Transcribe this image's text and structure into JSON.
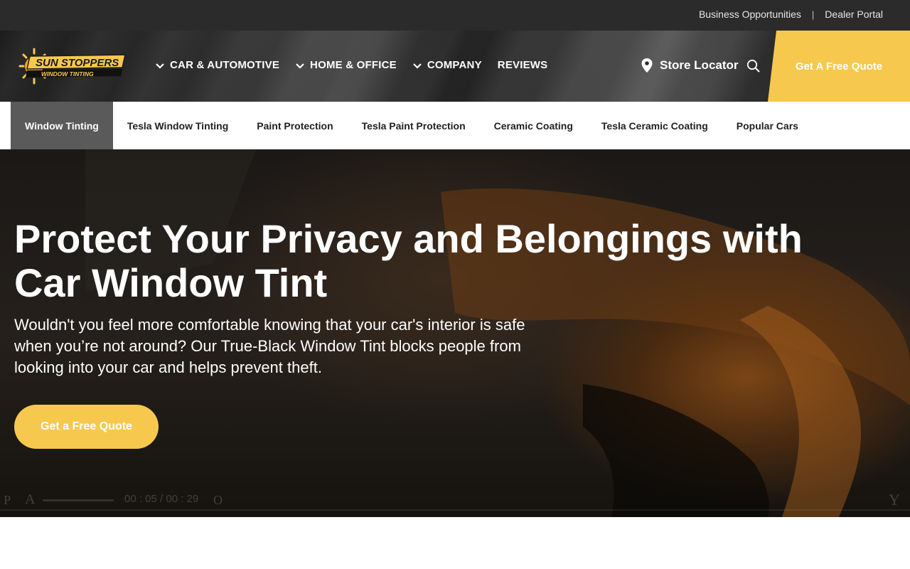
{
  "topbar": {
    "business_label": "Business Opportunities",
    "separator": "|",
    "dealer_label": "Dealer Portal"
  },
  "logo": {
    "line1": "SUN STOPPERS",
    "line2": "WINDOW TINTING"
  },
  "nav": {
    "items": [
      {
        "label": "CAR & AUTOMOTIVE",
        "has_dropdown": true
      },
      {
        "label": "HOME & OFFICE",
        "has_dropdown": true
      },
      {
        "label": "COMPANY",
        "has_dropdown": true
      },
      {
        "label": "REVIEWS",
        "has_dropdown": false
      }
    ],
    "store_locator": "Store Locator",
    "quote_label": "Get A Free Quote"
  },
  "subnav": {
    "tabs": [
      {
        "label": "Window Tinting",
        "active": true
      },
      {
        "label": "Tesla Window Tinting"
      },
      {
        "label": "Paint Protection"
      },
      {
        "label": "Tesla Paint Protection"
      },
      {
        "label": "Ceramic Coating"
      },
      {
        "label": "Tesla Ceramic Coating"
      },
      {
        "label": "Popular Cars"
      }
    ]
  },
  "hero": {
    "title": "Protect Your Privacy and Belongings with Car Window Tint",
    "body": "Wouldn't you feel more comfortable knowing that your car's interior is safe when you’re not around? Our True-Black Window Tint blocks people from looking into your car and helps prevent theft.",
    "cta_label": "Get a Free Quote"
  },
  "video": {
    "play_glyph": "P",
    "audio_glyph": "A",
    "time": "00 : 05 / 00 : 29",
    "options_glyph": "O",
    "fullscreen_glyph": "Y"
  },
  "colors": {
    "accent": "#f6c94e",
    "topbar": "#2b2b2b",
    "active_tab": "#5a5a5a"
  }
}
